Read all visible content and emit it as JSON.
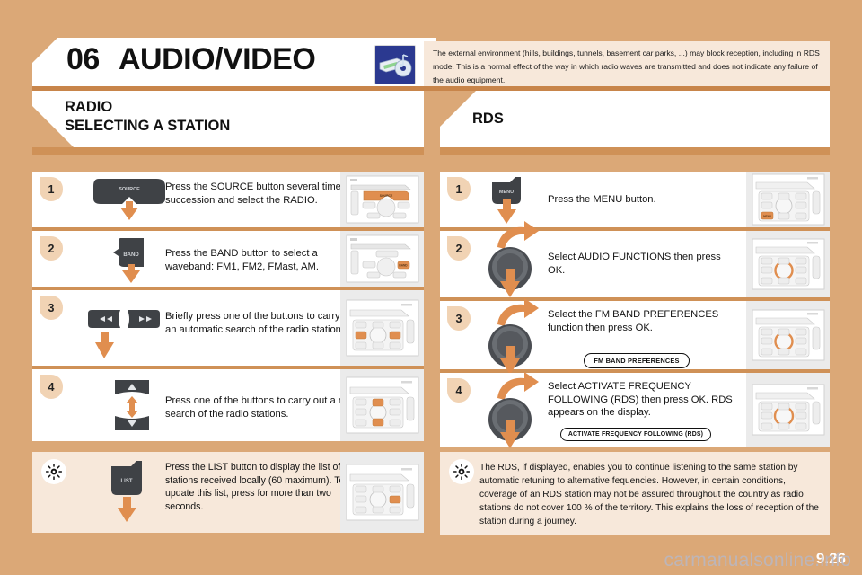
{
  "header": {
    "chapter_number": "06",
    "chapter_title": "AUDIO/VIDEO",
    "icon_name": "audio-video-icon",
    "note": "The external environment (hills, buildings, tunnels, basement car parks, ...) may block reception, including in RDS mode. This is a normal effect of the way in which radio waves are transmitted and does not indicate any failure of the audio equipment."
  },
  "left_column": {
    "section_title_line1": "RADIO",
    "section_title_line2": "SELECTING A STATION",
    "steps": [
      {
        "number": "1",
        "button_label": "SOURCE",
        "text": "Press the SOURCE button several times in succession and select the RADIO.",
        "thumb": "head-unit-source-highlighted"
      },
      {
        "number": "2",
        "button_label": "BAND",
        "text": "Press the BAND button to select a waveband: FM1, FM2, FMast, AM.",
        "thumb": "head-unit-band-highlighted"
      },
      {
        "number": "3",
        "button_label": "◄◄  ►►",
        "text": "Briefly press one of the buttons to carry out an automatic search of the radio stations.",
        "thumb": "keypad-prev-next-highlighted"
      },
      {
        "number": "4",
        "button_label": "▲ ▼",
        "text": "Press one of the buttons to carry out a manual search of the radio stations.",
        "thumb": "keypad-up-down-highlighted"
      }
    ],
    "tip": {
      "icon": "tip-bulb-icon",
      "button_label": "LIST",
      "text": "Press the LIST button to display the list of stations received locally (60 maximum).\nTo update this list, press for more than two seconds.",
      "thumb": "keypad-list-highlighted"
    }
  },
  "right_column": {
    "section_title_line1": "RDS",
    "steps": [
      {
        "number": "1",
        "button_label": "MENU",
        "text": "Press the MENU button.",
        "pill": "",
        "thumb": "keypad-menu-highlighted"
      },
      {
        "number": "2",
        "button_label": "rotary-knob",
        "text": "Select AUDIO FUNCTIONS then press OK.",
        "pill": "",
        "thumb": "keypad-ok-highlighted"
      },
      {
        "number": "3",
        "button_label": "rotary-knob",
        "text": "Select the FM BAND PREFERENCES function then press OK.",
        "pill": "FM BAND PREFERENCES",
        "thumb": "keypad-ok-highlighted"
      },
      {
        "number": "4",
        "button_label": "rotary-knob",
        "text": "Select ACTIVATE FREQUENCY FOLLOWING (RDS) then press OK. RDS appears on the display.",
        "pill": "ACTIVATE FREQUENCY FOLLOWING (RDS)",
        "thumb": "keypad-ok-highlighted"
      }
    ],
    "tip": {
      "icon": "tip-bulb-icon",
      "text": "The RDS, if displayed, enables you to continue listening to the same station by automatic retuning to alternative fequencies. However, in certain conditions, coverage of an RDS station may not be assured throughout the country as radio stations do not cover 100 % of the territory. This explains the loss of reception of the station during a journey."
    }
  },
  "footer": {
    "page_number": "9.26",
    "watermark": "carmanualsonline.info"
  },
  "colors": {
    "background": "#dba877",
    "panel": "#ffffff",
    "note_panel": "#f7e8da",
    "rule": "#cf9157",
    "accent_orange": "#e08e4f",
    "badge": "#f1d3b4",
    "icon_blue": "#2b3990"
  }
}
